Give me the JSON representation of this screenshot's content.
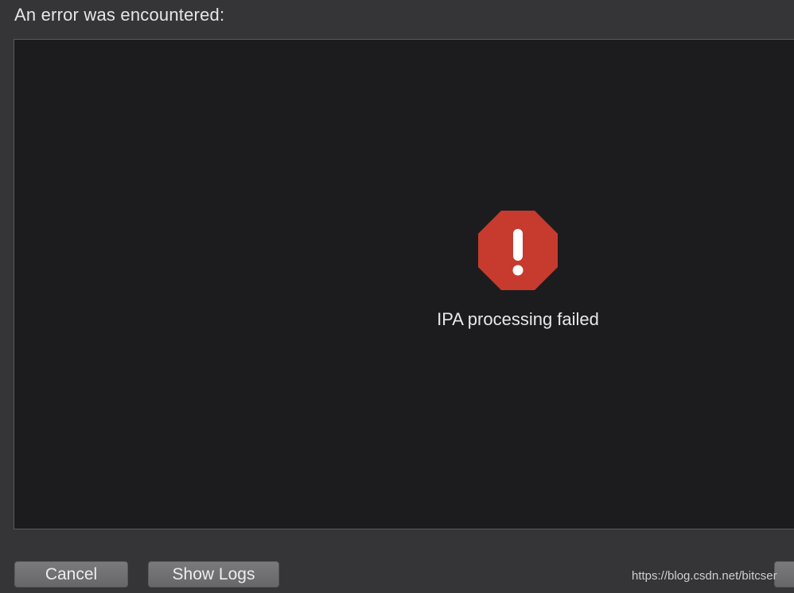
{
  "dialog": {
    "heading": "An error was encountered:"
  },
  "error": {
    "message": "IPA processing failed",
    "icon": "error-octagon-icon",
    "icon_color": "#c63b2e"
  },
  "buttons": {
    "cancel_label": "Cancel",
    "show_logs_label": "Show Logs"
  },
  "watermark": "https://blog.csdn.net/bitcser"
}
